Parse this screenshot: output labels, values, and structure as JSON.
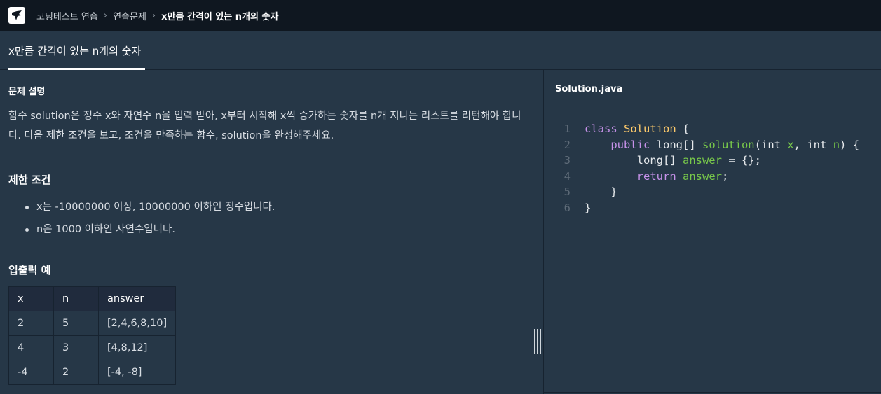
{
  "breadcrumb": [
    "코딩테스트 연습",
    "연습문제",
    "x만큼 간격이 있는 n개의 숫자"
  ],
  "problem_tab": "x만큼 간격이 있는 n개의 숫자",
  "description": {
    "heading": "문제 설명",
    "text": "함수 solution은 정수 x와 자연수 n을 입력 받아, x부터 시작해 x씩 증가하는 숫자를 n개 지니는 리스트를 리턴해야 합니다. 다음 제한 조건을 보고, 조건을 만족하는 함수, solution을 완성해주세요."
  },
  "constraints": {
    "heading": "제한 조건",
    "items": [
      "x는 -10000000 이상, 10000000 이하인 정수입니다.",
      "n은 1000 이하인 자연수입니다."
    ]
  },
  "examples": {
    "heading": "입출력 예",
    "columns": [
      "x",
      "n",
      "answer"
    ],
    "rows": [
      [
        "2",
        "5",
        "[2,4,6,8,10]"
      ],
      [
        "4",
        "3",
        "[4,8,12]"
      ],
      [
        "-4",
        "2",
        "[-4, -8]"
      ]
    ]
  },
  "editor": {
    "filename": "Solution.java",
    "line_numbers": [
      "1",
      "2",
      "3",
      "4",
      "5",
      "6"
    ]
  },
  "colors": {
    "keyword": "#c792ea",
    "class_name": "#ffcb6b",
    "identifier": "#78c84a",
    "background": "#263747",
    "topbar": "#0f1720"
  }
}
